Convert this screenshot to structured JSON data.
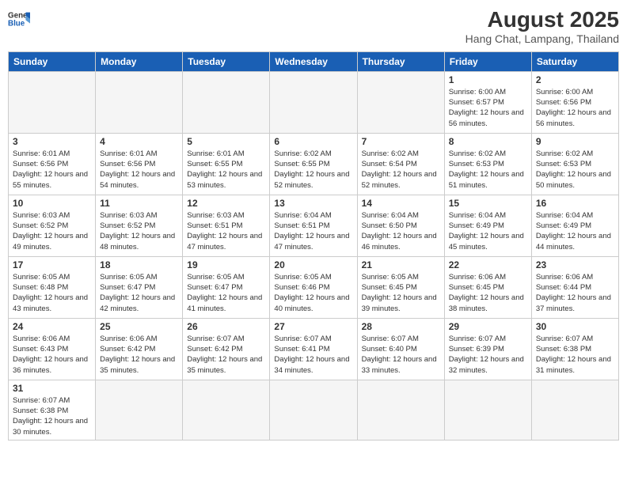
{
  "logo": {
    "general": "General",
    "blue": "Blue"
  },
  "title": "August 2025",
  "location": "Hang Chat, Lampang, Thailand",
  "days_of_week": [
    "Sunday",
    "Monday",
    "Tuesday",
    "Wednesday",
    "Thursday",
    "Friday",
    "Saturday"
  ],
  "weeks": [
    [
      {
        "day": "",
        "info": ""
      },
      {
        "day": "",
        "info": ""
      },
      {
        "day": "",
        "info": ""
      },
      {
        "day": "",
        "info": ""
      },
      {
        "day": "",
        "info": ""
      },
      {
        "day": "1",
        "info": "Sunrise: 6:00 AM\nSunset: 6:57 PM\nDaylight: 12 hours and 56 minutes."
      },
      {
        "day": "2",
        "info": "Sunrise: 6:00 AM\nSunset: 6:56 PM\nDaylight: 12 hours and 56 minutes."
      }
    ],
    [
      {
        "day": "3",
        "info": "Sunrise: 6:01 AM\nSunset: 6:56 PM\nDaylight: 12 hours and 55 minutes."
      },
      {
        "day": "4",
        "info": "Sunrise: 6:01 AM\nSunset: 6:56 PM\nDaylight: 12 hours and 54 minutes."
      },
      {
        "day": "5",
        "info": "Sunrise: 6:01 AM\nSunset: 6:55 PM\nDaylight: 12 hours and 53 minutes."
      },
      {
        "day": "6",
        "info": "Sunrise: 6:02 AM\nSunset: 6:55 PM\nDaylight: 12 hours and 52 minutes."
      },
      {
        "day": "7",
        "info": "Sunrise: 6:02 AM\nSunset: 6:54 PM\nDaylight: 12 hours and 52 minutes."
      },
      {
        "day": "8",
        "info": "Sunrise: 6:02 AM\nSunset: 6:53 PM\nDaylight: 12 hours and 51 minutes."
      },
      {
        "day": "9",
        "info": "Sunrise: 6:02 AM\nSunset: 6:53 PM\nDaylight: 12 hours and 50 minutes."
      }
    ],
    [
      {
        "day": "10",
        "info": "Sunrise: 6:03 AM\nSunset: 6:52 PM\nDaylight: 12 hours and 49 minutes."
      },
      {
        "day": "11",
        "info": "Sunrise: 6:03 AM\nSunset: 6:52 PM\nDaylight: 12 hours and 48 minutes."
      },
      {
        "day": "12",
        "info": "Sunrise: 6:03 AM\nSunset: 6:51 PM\nDaylight: 12 hours and 47 minutes."
      },
      {
        "day": "13",
        "info": "Sunrise: 6:04 AM\nSunset: 6:51 PM\nDaylight: 12 hours and 47 minutes."
      },
      {
        "day": "14",
        "info": "Sunrise: 6:04 AM\nSunset: 6:50 PM\nDaylight: 12 hours and 46 minutes."
      },
      {
        "day": "15",
        "info": "Sunrise: 6:04 AM\nSunset: 6:49 PM\nDaylight: 12 hours and 45 minutes."
      },
      {
        "day": "16",
        "info": "Sunrise: 6:04 AM\nSunset: 6:49 PM\nDaylight: 12 hours and 44 minutes."
      }
    ],
    [
      {
        "day": "17",
        "info": "Sunrise: 6:05 AM\nSunset: 6:48 PM\nDaylight: 12 hours and 43 minutes."
      },
      {
        "day": "18",
        "info": "Sunrise: 6:05 AM\nSunset: 6:47 PM\nDaylight: 12 hours and 42 minutes."
      },
      {
        "day": "19",
        "info": "Sunrise: 6:05 AM\nSunset: 6:47 PM\nDaylight: 12 hours and 41 minutes."
      },
      {
        "day": "20",
        "info": "Sunrise: 6:05 AM\nSunset: 6:46 PM\nDaylight: 12 hours and 40 minutes."
      },
      {
        "day": "21",
        "info": "Sunrise: 6:05 AM\nSunset: 6:45 PM\nDaylight: 12 hours and 39 minutes."
      },
      {
        "day": "22",
        "info": "Sunrise: 6:06 AM\nSunset: 6:45 PM\nDaylight: 12 hours and 38 minutes."
      },
      {
        "day": "23",
        "info": "Sunrise: 6:06 AM\nSunset: 6:44 PM\nDaylight: 12 hours and 37 minutes."
      }
    ],
    [
      {
        "day": "24",
        "info": "Sunrise: 6:06 AM\nSunset: 6:43 PM\nDaylight: 12 hours and 36 minutes."
      },
      {
        "day": "25",
        "info": "Sunrise: 6:06 AM\nSunset: 6:42 PM\nDaylight: 12 hours and 35 minutes."
      },
      {
        "day": "26",
        "info": "Sunrise: 6:07 AM\nSunset: 6:42 PM\nDaylight: 12 hours and 35 minutes."
      },
      {
        "day": "27",
        "info": "Sunrise: 6:07 AM\nSunset: 6:41 PM\nDaylight: 12 hours and 34 minutes."
      },
      {
        "day": "28",
        "info": "Sunrise: 6:07 AM\nSunset: 6:40 PM\nDaylight: 12 hours and 33 minutes."
      },
      {
        "day": "29",
        "info": "Sunrise: 6:07 AM\nSunset: 6:39 PM\nDaylight: 12 hours and 32 minutes."
      },
      {
        "day": "30",
        "info": "Sunrise: 6:07 AM\nSunset: 6:38 PM\nDaylight: 12 hours and 31 minutes."
      }
    ],
    [
      {
        "day": "31",
        "info": "Sunrise: 6:07 AM\nSunset: 6:38 PM\nDaylight: 12 hours and 30 minutes."
      },
      {
        "day": "",
        "info": ""
      },
      {
        "day": "",
        "info": ""
      },
      {
        "day": "",
        "info": ""
      },
      {
        "day": "",
        "info": ""
      },
      {
        "day": "",
        "info": ""
      },
      {
        "day": "",
        "info": ""
      }
    ]
  ],
  "empty_days_week1": [
    0,
    1,
    2,
    3,
    4
  ]
}
